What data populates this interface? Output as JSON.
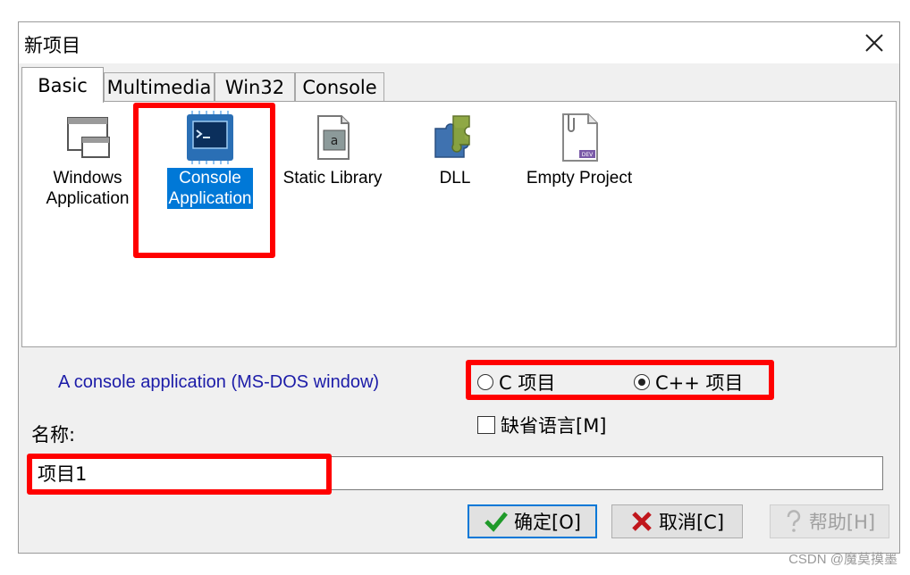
{
  "dialog": {
    "title": "新项目"
  },
  "tabs": [
    {
      "label": "Basic",
      "active": true
    },
    {
      "label": "Multimedia",
      "active": false
    },
    {
      "label": "Win32",
      "active": false
    },
    {
      "label": "Console",
      "active": false
    }
  ],
  "templates": [
    {
      "name": "windows-application",
      "label_line1": "Windows",
      "label_line2": "Application",
      "icon": "window-icon"
    },
    {
      "name": "console-application",
      "label_line1": "Console",
      "label_line2": "Application",
      "icon": "console-chip-icon",
      "selected": true
    },
    {
      "name": "static-library",
      "label_line1": "Static Library",
      "label_line2": "",
      "icon": "library-icon"
    },
    {
      "name": "dll",
      "label_line1": "DLL",
      "label_line2": "",
      "icon": "puzzle-icon"
    },
    {
      "name": "empty-project",
      "label_line1": "Empty Project",
      "label_line2": "",
      "icon": "empty-document-icon"
    }
  ],
  "description": "A console application (MS-DOS window)",
  "language": {
    "c_label": "C 项目",
    "cpp_label": "C++ 项目",
    "selected": "C++ 项目"
  },
  "default_language_label": "缺省语言[M]",
  "name_field": {
    "label": "名称:",
    "value": "项目1"
  },
  "buttons": {
    "ok": "确定[O]",
    "cancel": "取消[C]",
    "help": "帮助[H]"
  },
  "watermark": "CSDN @魔莫摸墨",
  "colors": {
    "selection": "#0078d7",
    "highlight": "#ff0000",
    "description": "#1c1ca8"
  }
}
